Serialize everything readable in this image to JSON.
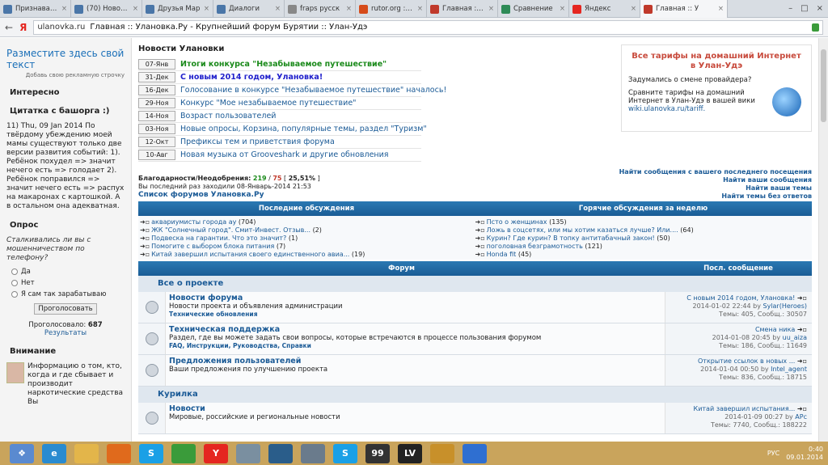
{
  "browser": {
    "tabs": [
      {
        "label": "Признавайтес",
        "icon": "vk-icon",
        "color": "#4a76a8"
      },
      {
        "label": "(70) Новости",
        "icon": "vk-icon",
        "color": "#4a76a8"
      },
      {
        "label": "Друзья Мар",
        "icon": "vk-icon",
        "color": "#4a76a8"
      },
      {
        "label": "Диалоги",
        "icon": "vk-icon",
        "color": "#4a76a8"
      },
      {
        "label": "fraps русск",
        "icon": "globe-icon",
        "color": "#888888"
      },
      {
        "label": "rutor.org :: Г",
        "icon": "rutor-icon",
        "color": "#d64b1a"
      },
      {
        "label": "Главная :: У",
        "icon": "site-icon",
        "color": "#c0392b"
      },
      {
        "label": "Сравнение",
        "icon": "site-icon",
        "color": "#2e8b57"
      },
      {
        "label": "Яндекс",
        "icon": "yandex-icon",
        "color": "#e52620"
      },
      {
        "label": "Главная :: У",
        "icon": "site-icon",
        "color": "#c0392b",
        "active": true
      }
    ],
    "host": "ulanovka.ru",
    "page_title": "Главная :: Улановка.Ру - Крупнейший форум Бурятии :: Улан-Удэ",
    "nav_back": "←",
    "nav_yandex": "Я"
  },
  "left": {
    "adv_title": "Разместите здесь свой текст",
    "adv_sub": "Добавь свою рекламную строчку",
    "interesting": "Интересно",
    "quote_title": "Цитатка с башорга :)",
    "quote_text": "11) Thu, 09 Jan 2014 По твёрдому убеждению моей мамы существуют только две версии развития событий: 1). Ребёнок похудел => значит нечего есть => голодает 2). Ребёнок поправился => значит нечего есть => распух на макаронах с картошкой. А в остальном она адекватная.",
    "poll_title": "Опрос",
    "poll_q": "Сталкивались ли вы с мошенничеством по телефону?",
    "poll_opts": [
      "Да",
      "Нет",
      "Я сам так зарабатываю"
    ],
    "vote_btn": "Проголосовать",
    "voted_label": "Проголосовало:",
    "voted_count": "687",
    "results": "Результаты",
    "attention": "Внимание",
    "attention_text": "Информацию о том, кто, когда и где сбывает и производит наркотические средства Вы"
  },
  "news": {
    "title": "Новости Улановки",
    "items": [
      {
        "date": "07-Янв",
        "text": "Итоги конкурса \"Незабываемое путешествие\"",
        "style": "green"
      },
      {
        "date": "31-Дек",
        "text": "С новым 2014 годом, Улановка!",
        "style": "blue"
      },
      {
        "date": "16-Дек",
        "text": "Голосование в конкурсе \"Незабываемое путешествие\" началось!",
        "style": ""
      },
      {
        "date": "29-Ноя",
        "text": "Конкурс \"Мое незабываемое путешествие\"",
        "style": ""
      },
      {
        "date": "14-Ноя",
        "text": "Возраст пользователей",
        "style": ""
      },
      {
        "date": "03-Ноя",
        "text": "Новые опросы, Корзина, популярные темы, раздел \"Туризм\"",
        "style": ""
      },
      {
        "date": "12-Окт",
        "text": "Префиксы тем и приветствия форума",
        "style": ""
      },
      {
        "date": "10-Авг",
        "text": "Новая музыка от Grooveshark и другие обновления",
        "style": ""
      }
    ]
  },
  "ad": {
    "title": "Все тарифы на домашний Интернет в Улан-Удэ",
    "p1": "Задумались о смене провайдера?",
    "p2": "Сравните тарифы на домашний Интернет в Улан-Удэ в вашей вики",
    "link": "wiki.ulanovka.ru/tariff."
  },
  "stats": {
    "thanks_label": "Благодарности/Неодобрения:",
    "plus": "219",
    "minus": "75",
    "pct": "25,51%",
    "last_visit": "Вы последний раз заходили 08-Январь-2014 21:53",
    "forums_list": "Список форумов Улановка.Ру"
  },
  "links": [
    "Найти сообщения с вашего последнего посещения",
    "Найти ваши сообщения",
    "Найти ваши темы",
    "Найти темы без ответов"
  ],
  "disc": {
    "h_left": "Последние обсуждения",
    "h_right": "Горячие обсуждения за неделю",
    "left": [
      {
        "t": "аквариумисты города ау",
        "n": "(704)"
      },
      {
        "t": "ЖК \"Солнечный город\". Смит-Инвест. Отзыв...",
        "n": "(2)"
      },
      {
        "t": "Подвеска на гарантии. Что это значит?",
        "n": "(1)"
      },
      {
        "t": "Помогите с выбором блока питания",
        "n": "(7)"
      },
      {
        "t": "Китай завершил испытания своего единственного авиа...",
        "n": "(19)"
      }
    ],
    "right": [
      {
        "t": "Псто о женщинах",
        "n": "(135)"
      },
      {
        "t": "Ложь в соцсетях, или мы хотим казаться лучше? Или....",
        "n": "(64)"
      },
      {
        "t": "Курин? Где курин? В топку антитабачный закон!",
        "n": "(50)"
      },
      {
        "t": "поголовная безграмотность",
        "n": "(121)"
      },
      {
        "t": "Honda fit",
        "n": "(45)"
      }
    ]
  },
  "forum": {
    "h_forum": "Форум",
    "h_last": "Посл. сообщение",
    "cat1": "Все о проекте",
    "cat2": "Курилка",
    "rows": [
      {
        "name": "Новости форума",
        "desc": "Новости проекта и объявления администрации",
        "sub": "Технические обновления",
        "last_title": "С новым 2014 годом, Улановка!",
        "last_date": "2014-01-02 22:44",
        "last_by": "by",
        "last_user": "Sylar(Heroes)",
        "topics": "Темы: 405, Сообщ.: 30507"
      },
      {
        "name": "Техническая поддержка",
        "desc": "Раздел, где вы можете задать свои вопросы, которые встречаются в процессе пользования форумом",
        "sub": "FAQ, Инструкции, Руководства, Справки",
        "last_title": "Смена ника",
        "last_date": "2014-01-08 20:45",
        "last_by": "by",
        "last_user": "uu_aiza",
        "topics": "Темы: 186, Сообщ.: 11649"
      },
      {
        "name": "Предложения пользователей",
        "desc": "Ваши предложения по улучшению проекта",
        "sub": "",
        "last_title": "Открытие ссылок в новых ...",
        "last_date": "2014-01-04 00:50",
        "last_by": "by",
        "last_user": "Intel_agent",
        "topics": "Темы: 836, Сообщ.: 18715"
      },
      {
        "name": "Новости",
        "desc": "Мировые, российские и региональные новости",
        "sub": "",
        "last_title": "Китай завершил испытания...",
        "last_date": "2014-01-09 00:27",
        "last_by": "by",
        "last_user": "APc",
        "topics": "Темы: 7740, Сообщ.: 188222"
      }
    ]
  },
  "taskbar": {
    "apps": [
      {
        "name": "ie-icon",
        "color": "#2a8bd0",
        "label": "e"
      },
      {
        "name": "folder-icon",
        "color": "#e3b54a",
        "label": ""
      },
      {
        "name": "media-icon",
        "color": "#e06a1c",
        "label": ""
      },
      {
        "name": "skype-icon",
        "color": "#1aa0e6",
        "label": "S"
      },
      {
        "name": "chrome-icon",
        "color": "#3a9b3a",
        "label": ""
      },
      {
        "name": "yandex-browser-icon",
        "color": "#e52620",
        "label": "Y"
      },
      {
        "name": "paint-icon",
        "color": "#7a8fa0",
        "label": ""
      },
      {
        "name": "steam-icon",
        "color": "#2a5d8a",
        "label": ""
      },
      {
        "name": "calc-icon",
        "color": "#6a7b8c",
        "label": ""
      },
      {
        "name": "skype2-icon",
        "color": "#1aa0e6",
        "label": "S"
      },
      {
        "name": "fraps-icon",
        "color": "#333333",
        "label": "99"
      },
      {
        "name": "lv-icon",
        "color": "#222222",
        "label": "LV"
      },
      {
        "name": "game-icon",
        "color": "#c8902a",
        "label": ""
      },
      {
        "name": "itunes-icon",
        "color": "#2f6fd1",
        "label": ""
      }
    ],
    "lang": "РУС",
    "time": "0:40",
    "date": "09.01.2014"
  }
}
